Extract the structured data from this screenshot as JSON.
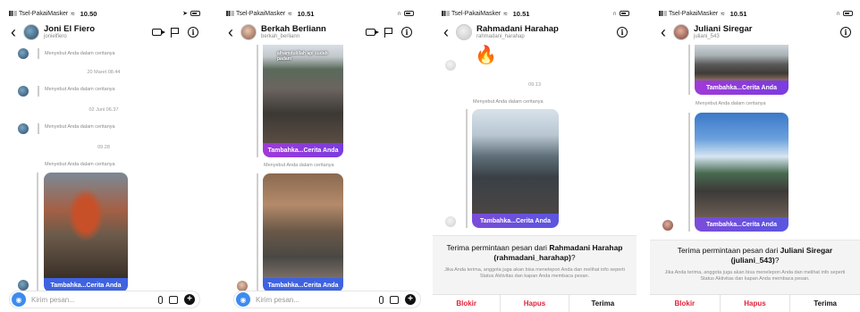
{
  "screens": [
    {
      "status": {
        "carrier": "Tsel-PakaiMasker",
        "time": "10.50"
      },
      "header": {
        "name": "Joni El Fiero",
        "handle": "jonielfiero"
      },
      "messages": {
        "mention1": "Menyebut Anda dalam ceritanya",
        "stamp1": "20 Maret 08.44",
        "mention2": "Menyebut Anda dalam ceritanya",
        "stamp2": "02 Juni 06.37",
        "mention3": "Menyebut Anda dalam ceritanya",
        "stamp3": "09.28",
        "mention4": "Menyebut Anda dalam ceritanya"
      },
      "story_label": "Tambahka...Cerita Anda",
      "input": {
        "placeholder": "Kirim pesan..."
      }
    },
    {
      "status": {
        "carrier": "Tsel-PakaiMasker",
        "time": "10.51"
      },
      "header": {
        "name": "Berkah Berliann",
        "handle": "berkah_berliann"
      },
      "story_top_label": "Tambahka...Cerita Anda",
      "story_top_caption": "alhamdulillah api sudah padam",
      "mention": "Menyebut Anda dalam ceritanya",
      "story_bottom_label": "Tambahka...Cerita Anda",
      "input": {
        "placeholder": "Kirim pesan..."
      }
    },
    {
      "status": {
        "carrier": "Tsel-PakaiMasker",
        "time": "10.51"
      },
      "header": {
        "name": "Rahmadani Harahap",
        "handle": "rahmadani_harahap"
      },
      "stamp": "09.13",
      "mention": "Menyebut Anda dalam ceritanya",
      "story_label": "Tambahka...Cerita Anda",
      "request": {
        "title_prefix": "Terima permintaan pesan dari",
        "title_name": "Rahmadani Harahap (rahmadani_harahap)",
        "title_suffix": "?",
        "desc": "Jika Anda terima, anggota juga akan bisa menelepon Anda dan melihat info seperti Status Aktivitas dan kapan Anda membaca pesan."
      },
      "actions": {
        "block": "Blokir",
        "delete": "Hapus",
        "accept": "Terima"
      }
    },
    {
      "status": {
        "carrier": "Tsel-PakaiMasker",
        "time": "10.51"
      },
      "header": {
        "name": "Juliani Siregar",
        "handle": "juliani_543"
      },
      "story_top_label": "Tambahka...Cerita Anda",
      "mention": "Menyebut Anda dalam ceritanya",
      "story_bottom_label": "Tambahka...Cerita Anda",
      "request": {
        "title_prefix": "Terima permintaan pesan dari",
        "title_name": "Juliani Siregar (juliani_543)",
        "title_suffix": "?",
        "desc": "Jika Anda terima, anggota juga akan bisa menelepon Anda dan melihat info seperti Status Aktivitas dan kapan Anda membaca pesan."
      },
      "actions": {
        "block": "Blokir",
        "delete": "Hapus",
        "accept": "Terima"
      }
    }
  ]
}
